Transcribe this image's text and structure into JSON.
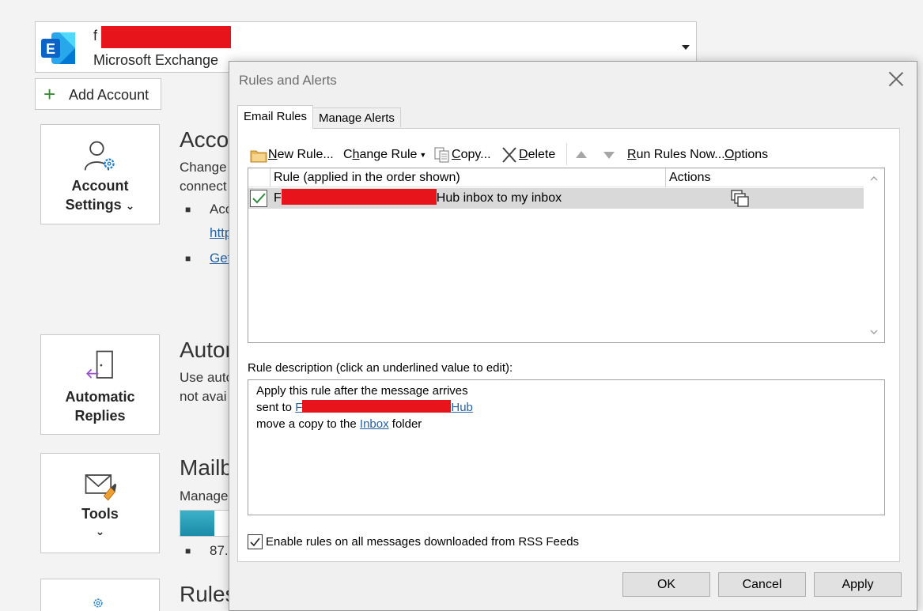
{
  "account": {
    "name_visible": "f",
    "type": "Microsoft Exchange",
    "add_account_label": "Add Account"
  },
  "tiles": {
    "account_settings": {
      "line1": "Account",
      "line2": "Settings",
      "chevron": "⌄"
    },
    "automatic_replies": {
      "line1": "Automatic",
      "line2": "Replies"
    },
    "tools": {
      "line1": "Tools",
      "chevron": "⌄"
    }
  },
  "sections": {
    "account": {
      "title": "Acco",
      "text1": "Change",
      "text2": "connect",
      "bullet1": "Acc",
      "bullet1_link": "http",
      "bullet2_link": "Get"
    },
    "auto": {
      "title": "Autor",
      "text1": "Use auto",
      "text2": "not avai"
    },
    "mailbox": {
      "title": "Mailb",
      "text1": "Manage",
      "bullet1": "87.",
      "usage_fraction": 0.7
    },
    "rules": {
      "title": "Rules"
    }
  },
  "dialog": {
    "title": "Rules and Alerts",
    "tabs": [
      "Email Rules",
      "Manage Alerts"
    ],
    "toolbar": {
      "new_rule": {
        "u": "N",
        "rest": "ew Rule..."
      },
      "change_rule": {
        "pre": "C",
        "u": "h",
        "rest": "ange Rule"
      },
      "copy": {
        "u": "C",
        "rest": "opy..."
      },
      "delete": {
        "u": "D",
        "rest": "elete"
      },
      "run_rules": {
        "u": "R",
        "rest": "un Rules Now..."
      },
      "options": {
        "u": "O",
        "rest": "ptions"
      }
    },
    "columns": {
      "rule": "Rule (applied in the order shown)",
      "actions": "Actions"
    },
    "rules": [
      {
        "prefix": "F",
        "suffix": "Hub inbox to my inbox",
        "enabled": true
      }
    ],
    "description_label": "Rule description (click an underlined value to edit):",
    "description": {
      "line1": "Apply this rule after the message arrives",
      "line2_pre": "sent to ",
      "line2_link_start": "F",
      "line2_link_end": "Hub",
      "line3_pre": "move a copy to the ",
      "line3_link": "Inbox",
      "line3_post": " folder"
    },
    "rss_label": "Enable rules on all messages downloaded from RSS Feeds",
    "rss_checked": true,
    "buttons": {
      "ok": "OK",
      "cancel": "Cancel",
      "apply": "Apply"
    }
  },
  "colors": {
    "accent_link": "#2563a6",
    "redaction": "#e8141c",
    "exchange_blue": "#0a64c8"
  }
}
